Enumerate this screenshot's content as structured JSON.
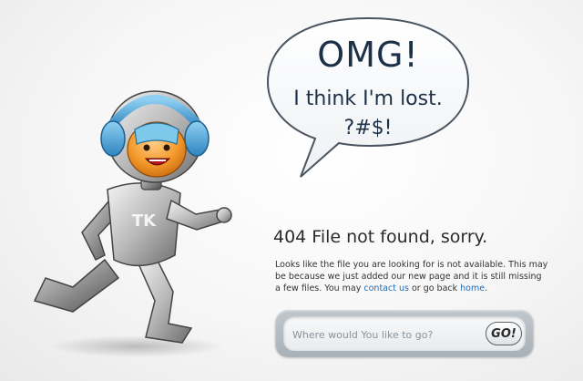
{
  "speech_bubble": {
    "headline": "OMG!",
    "line1": "I think I'm lost.",
    "line2": "?#$!"
  },
  "error": {
    "title": "404 File not found, sorry.",
    "text_part1": "Looks like the file you are looking for is not available. This may be because we just added our new page and it is still missing a few files. You may ",
    "contact_link": "contact us",
    "text_part2": " or go back ",
    "home_link": "home",
    "text_part3": "."
  },
  "search": {
    "placeholder": "Where would You like to go?",
    "button_label": "GO!"
  },
  "mascot": {
    "chest_letters": "TK"
  },
  "colors": {
    "link": "#1e6bb8",
    "headphone_blue": "#4aa3d8",
    "face_orange": "#f39a2b",
    "bubble_text": "#1c3048"
  }
}
